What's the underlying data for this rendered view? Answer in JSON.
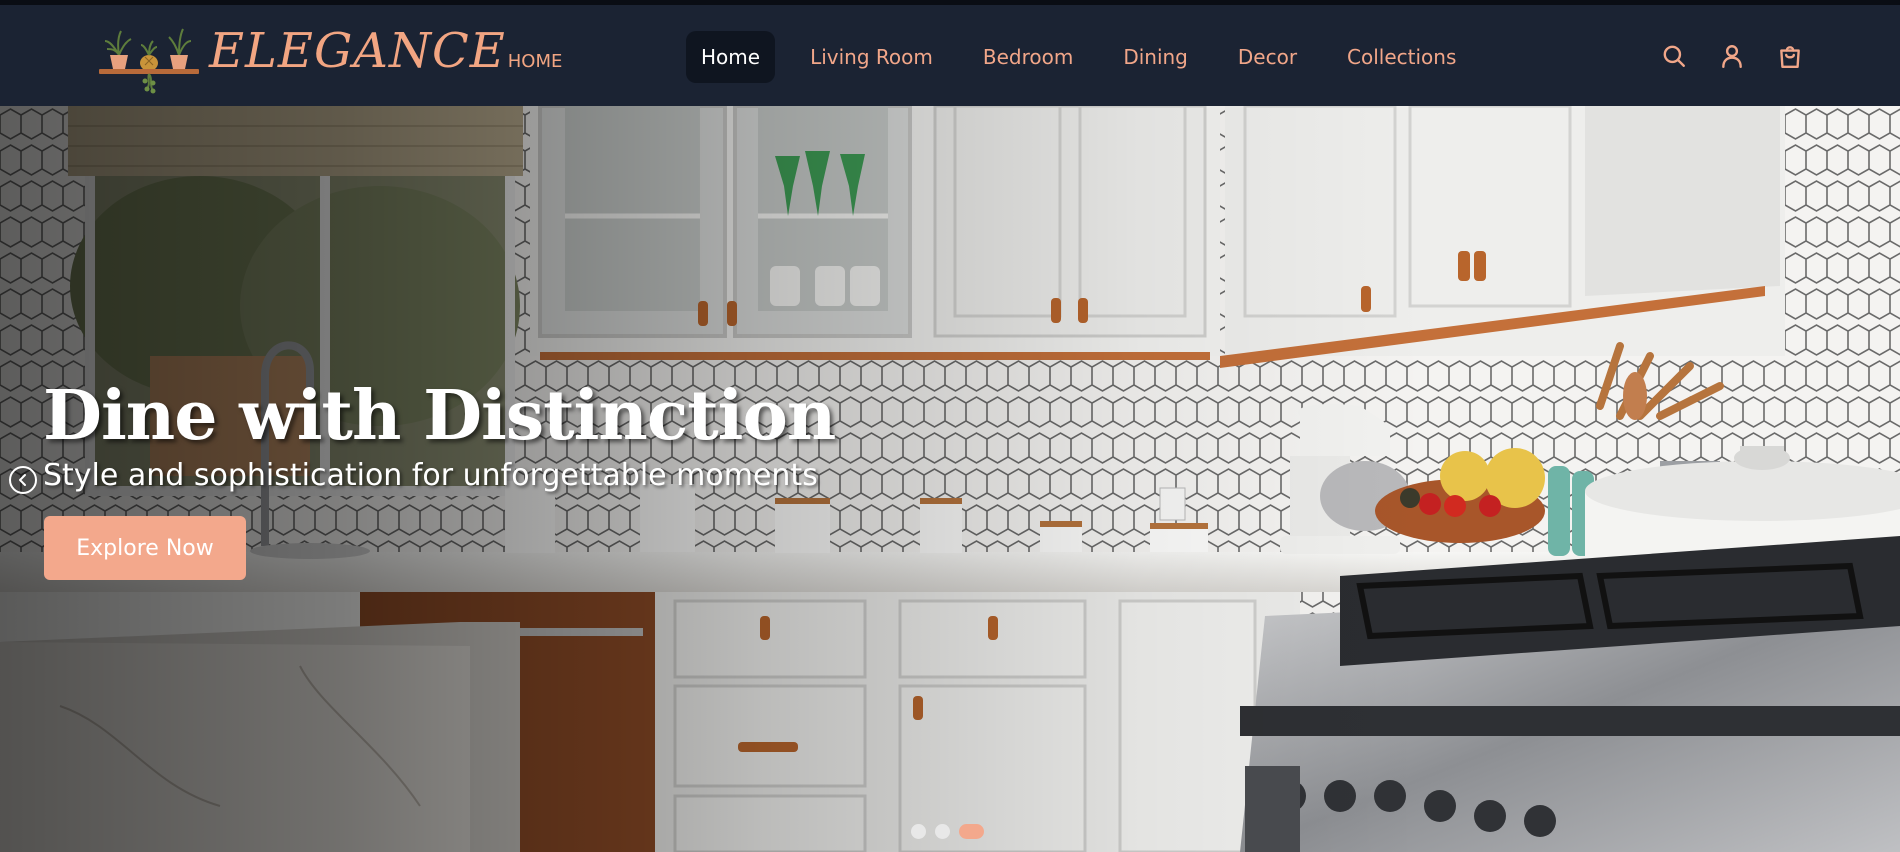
{
  "brand": {
    "name": "ELEGANCE",
    "suffix": "HOME",
    "logo_icon": "plant-shelf-icon",
    "accent_color": "#f2a582"
  },
  "nav": {
    "items": [
      {
        "label": "Home",
        "active": true
      },
      {
        "label": "Living Room",
        "active": false
      },
      {
        "label": "Bedroom",
        "active": false
      },
      {
        "label": "Dining",
        "active": false
      },
      {
        "label": "Decor",
        "active": false
      },
      {
        "label": "Collections",
        "active": false
      }
    ],
    "icons": [
      "search-icon",
      "user-icon",
      "shopping-bag-icon"
    ],
    "background": "#1b2333"
  },
  "hero": {
    "title": "Dine with Distinction",
    "subtitle": "Style and sophistication for unforgettable moments",
    "cta_label": "Explore Now",
    "cta_color": "#f3a88c",
    "prev_icon": "chevron-left-icon",
    "slides": {
      "count": 3,
      "active_index": 2
    }
  }
}
